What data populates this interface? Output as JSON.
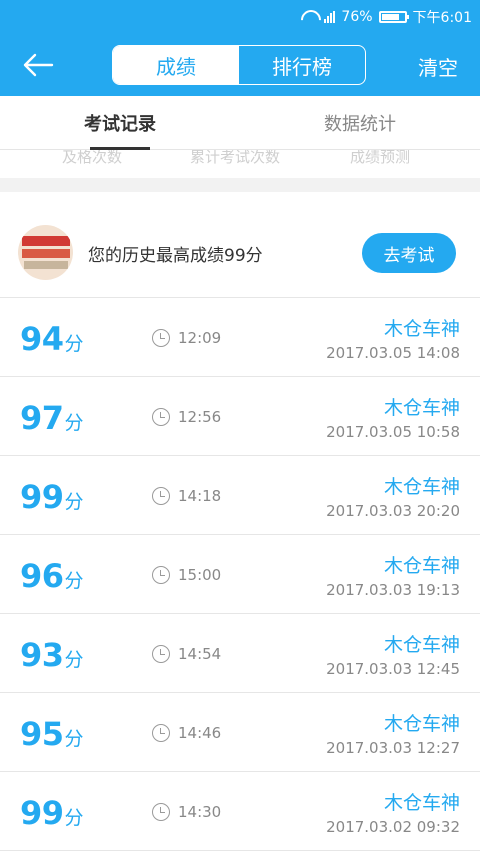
{
  "status_bar": {
    "battery": "76%",
    "time": "下午6:01",
    "battery_level": 0.76,
    "icons": [
      "wifi-icon",
      "signal-icon",
      "battery-icon"
    ]
  },
  "header": {
    "back_icon": "arrow-left-icon",
    "tabs": [
      {
        "label": "成绩",
        "active": true
      },
      {
        "label": "排行榜",
        "active": false
      }
    ],
    "clear_label": "清空"
  },
  "subtabs": [
    {
      "label": "考试记录",
      "active": true
    },
    {
      "label": "数据统计",
      "active": false
    }
  ],
  "stats_peek": [
    "及格次数",
    "累计考试次数",
    "成绩预测"
  ],
  "best": {
    "text": "您的历史最高成绩99分",
    "button": "去考试"
  },
  "score_unit": "分",
  "records": [
    {
      "score": "94",
      "duration": "12:09",
      "user": "木仓车神",
      "date": "2017.03.05  14:08"
    },
    {
      "score": "97",
      "duration": "12:56",
      "user": "木仓车神",
      "date": "2017.03.05  10:58"
    },
    {
      "score": "99",
      "duration": "14:18",
      "user": "木仓车神",
      "date": "2017.03.03  20:20"
    },
    {
      "score": "96",
      "duration": "15:00",
      "user": "木仓车神",
      "date": "2017.03.03  19:13"
    },
    {
      "score": "93",
      "duration": "14:54",
      "user": "木仓车神",
      "date": "2017.03.03  12:45"
    },
    {
      "score": "95",
      "duration": "14:46",
      "user": "木仓车神",
      "date": "2017.03.03  12:27"
    },
    {
      "score": "99",
      "duration": "14:30",
      "user": "木仓车神",
      "date": "2017.03.02  09:32"
    }
  ],
  "colors": {
    "accent": "#24a9f0",
    "text_dark": "#333333",
    "text_gray": "#888888"
  }
}
